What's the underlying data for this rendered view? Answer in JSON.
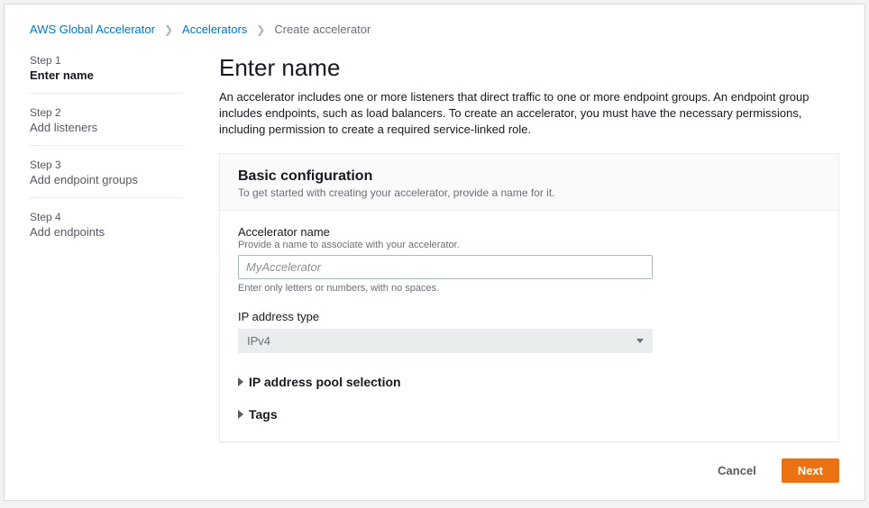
{
  "breadcrumb": {
    "root": "AWS Global Accelerator",
    "section": "Accelerators",
    "current": "Create accelerator"
  },
  "steps": [
    {
      "num": "Step 1",
      "title": "Enter name"
    },
    {
      "num": "Step 2",
      "title": "Add listeners"
    },
    {
      "num": "Step 3",
      "title": "Add endpoint groups"
    },
    {
      "num": "Step 4",
      "title": "Add endpoints"
    }
  ],
  "page": {
    "title": "Enter name",
    "description": "An accelerator includes one or more listeners that direct traffic to one or more endpoint groups. An endpoint group includes endpoints, such as load balancers. To create an accelerator, you must have the necessary permissions, including permission to create a required service-linked role."
  },
  "panel": {
    "title": "Basic configuration",
    "subtitle": "To get started with creating your accelerator, provide a name for it."
  },
  "fields": {
    "name": {
      "label": "Accelerator name",
      "hint": "Provide a name to associate with your accelerator.",
      "placeholder": "MyAccelerator",
      "constraint": "Enter only letters or numbers, with no spaces."
    },
    "ipType": {
      "label": "IP address type",
      "value": "IPv4"
    },
    "ipPool": {
      "label": "IP address pool selection"
    },
    "tags": {
      "label": "Tags"
    }
  },
  "actions": {
    "cancel": "Cancel",
    "next": "Next"
  }
}
